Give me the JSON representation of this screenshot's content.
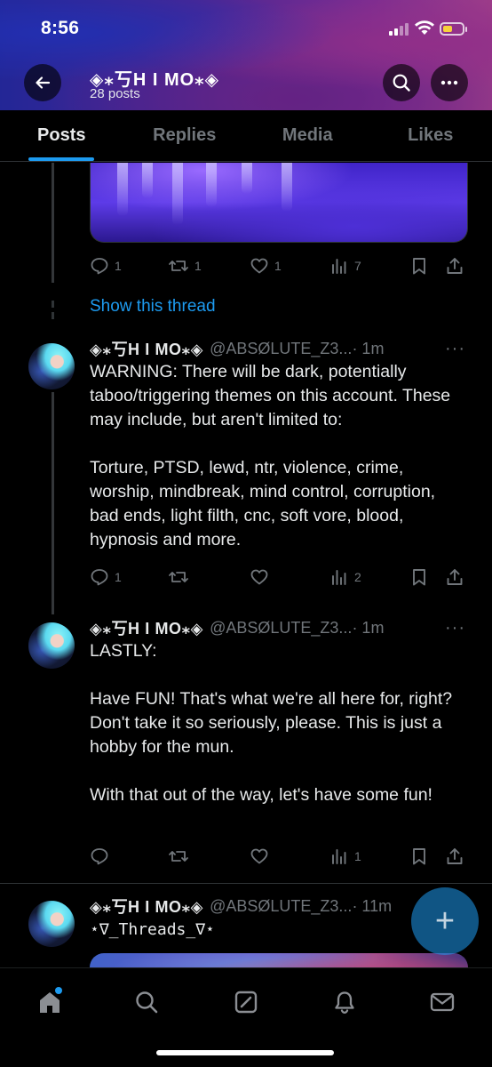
{
  "status_bar": {
    "time": "8:56",
    "battery_level": 0.5
  },
  "profile": {
    "name": "◈⁎丂H I MO⁎◈",
    "posts_count": "28 posts"
  },
  "tabs": [
    {
      "label": "Posts",
      "active": true
    },
    {
      "label": "Replies",
      "active": false
    },
    {
      "label": "Media",
      "active": false
    },
    {
      "label": "Likes",
      "active": false
    }
  ],
  "prev_post": {
    "stats": {
      "replies": "1",
      "reposts": "1",
      "likes": "1",
      "views": "7"
    },
    "show_thread": "Show this thread"
  },
  "posts": [
    {
      "name": "◈⁎丂H I MO⁎◈",
      "handle": "@ABSØLUTE_Z3...",
      "time": "· 1m",
      "text": "WARNING: There will be dark, potentially taboo/triggering themes on this account. These may include, but aren't limited to:\n\nTorture, PTSD, lewd, ntr, violence, crime, worship, mindbreak, mind control, corruption, bad ends, light filth, cnc, soft vore, blood, hypnosis and more.",
      "stats": {
        "replies": "1",
        "reposts": "",
        "likes": "",
        "views": "2"
      }
    },
    {
      "name": "◈⁎丂H I MO⁎◈",
      "handle": "@ABSØLUTE_Z3...",
      "time": "· 1m",
      "text": "LASTLY:\n\nHave FUN! That's what we're all here for, right? Don't take it so seriously, please. This is just a hobby for the mun.\n\nWith that out of the way, let's have some fun!",
      "stats": {
        "replies": "",
        "reposts": "",
        "likes": "",
        "views": "1"
      }
    },
    {
      "name": "◈⁎丂H I MO⁎◈",
      "handle": "@ABSØLUTE_Z3...",
      "time": "· 11m",
      "text": "⋆∇_Threads_∇⋆"
    }
  ],
  "icons": {
    "back": "arrow-left-icon",
    "search": "search-icon",
    "more": "ellipsis-icon",
    "reply": "speech-bubble-icon",
    "repost": "repost-arrows-icon",
    "like": "heart-icon",
    "views": "bar-chart-icon",
    "bookmark": "bookmark-icon",
    "share": "share-icon",
    "compose": "plus-icon",
    "nav": [
      "home-icon",
      "search-icon",
      "grok-icon",
      "bell-icon",
      "mail-icon"
    ]
  },
  "colors": {
    "accent": "#1d9bf0",
    "background": "#000000",
    "muted": "#71767b",
    "text": "#e7e9ea"
  }
}
